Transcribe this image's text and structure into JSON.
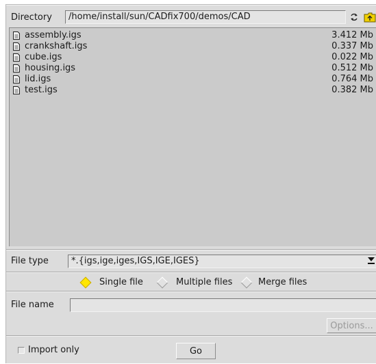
{
  "directory": {
    "label": "Directory",
    "path": "/home/install/sun/CADfix700/demos/CAD",
    "refresh_icon": "refresh-icon",
    "parent_icon": "folder-up-icon"
  },
  "files": [
    {
      "name": "assembly.igs",
      "size": "3.412 Mb"
    },
    {
      "name": "crankshaft.igs",
      "size": "0.337 Mb"
    },
    {
      "name": "cube.igs",
      "size": "0.022 Mb"
    },
    {
      "name": "housing.igs",
      "size": "0.512 Mb"
    },
    {
      "name": "lid.igs",
      "size": "0.764 Mb"
    },
    {
      "name": "test.igs",
      "size": "0.382 Mb"
    }
  ],
  "file_type": {
    "label": "File type",
    "value": "*.{igs,ige,iges,IGS,IGE,IGES}"
  },
  "mode": {
    "options": [
      "Single file",
      "Multiple files",
      "Merge files"
    ],
    "selected": "Single file"
  },
  "file_name": {
    "label": "File name",
    "value": ""
  },
  "options_button": "Options...",
  "import_only_label": "Import only",
  "go_button": "Go",
  "colors": {
    "panel": "#dcdcdc",
    "list_bg": "#cbcbcb",
    "radio_selected": "#ffe600",
    "folder_icon": "#f0d000"
  }
}
